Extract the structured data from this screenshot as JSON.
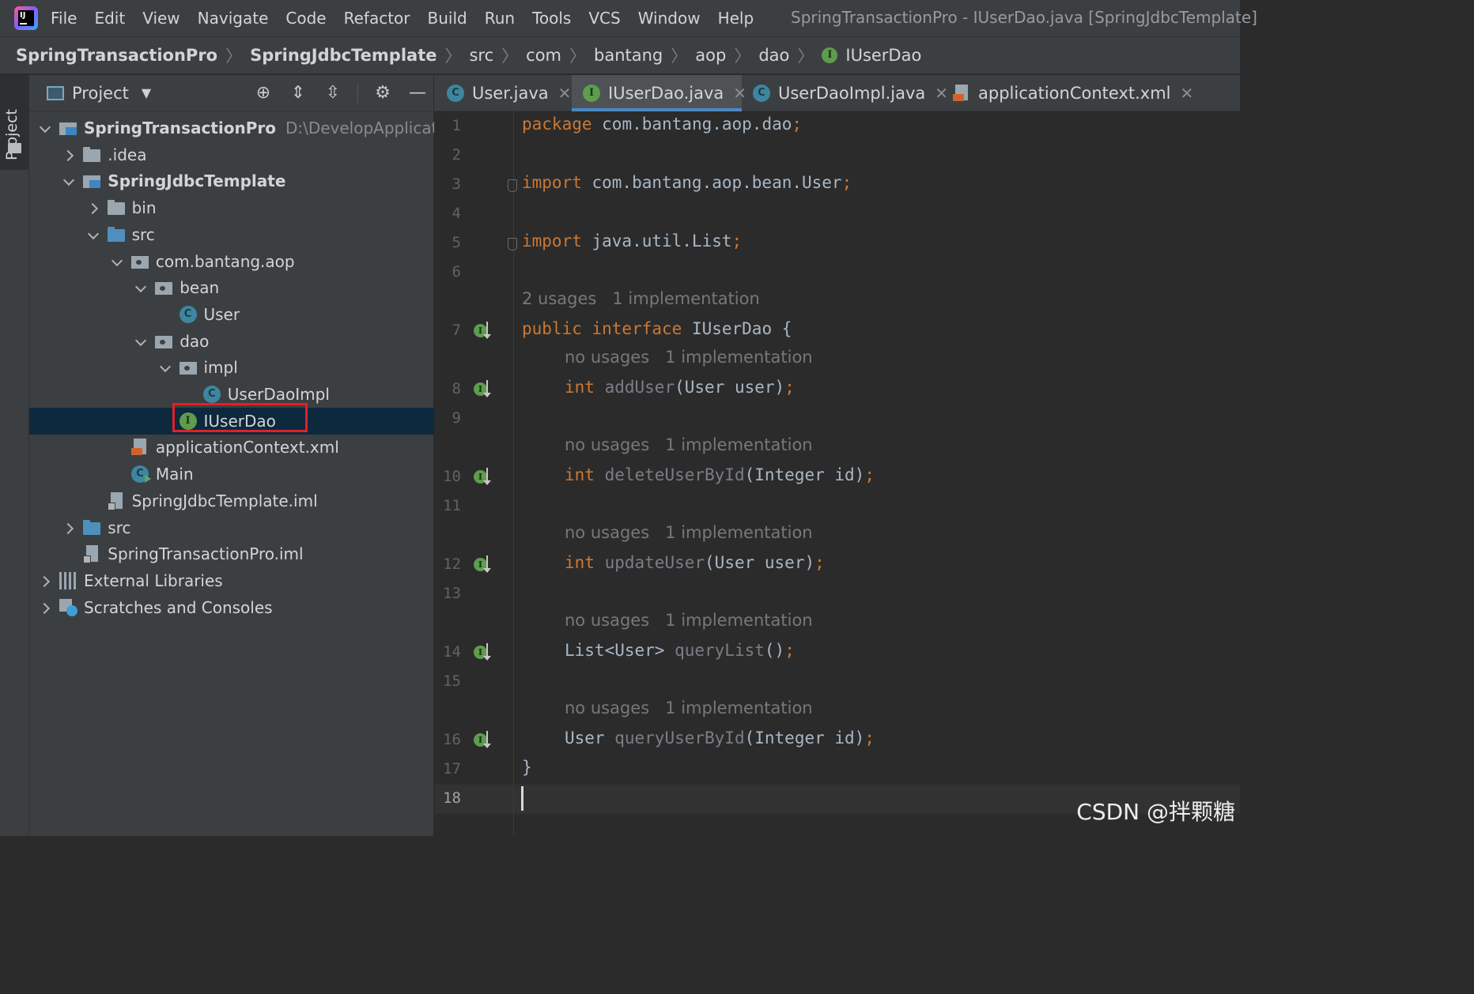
{
  "menubar": {
    "items": [
      "File",
      "Edit",
      "View",
      "Navigate",
      "Code",
      "Refactor",
      "Build",
      "Run",
      "Tools",
      "VCS",
      "Window",
      "Help"
    ],
    "window_title": "SpringTransactionPro - IUserDao.java [SpringJdbcTemplate]"
  },
  "breadcrumb": [
    "SpringTransactionPro",
    "SpringJdbcTemplate",
    "src",
    "com",
    "bantang",
    "aop",
    "dao",
    "IUserDao"
  ],
  "side_stripe": {
    "label": "Project"
  },
  "project_panel": {
    "title": "Project",
    "tree": [
      {
        "label": "SpringTransactionPro",
        "path": "D:\\DevelopApplicatio",
        "depth": 0,
        "arrow": "down",
        "icon": "module-folder",
        "bold": true
      },
      {
        "label": ".idea",
        "depth": 1,
        "arrow": "right",
        "icon": "folder"
      },
      {
        "label": "SpringJdbcTemplate",
        "depth": 1,
        "arrow": "down",
        "icon": "module-folder",
        "bold": true
      },
      {
        "label": "bin",
        "depth": 2,
        "arrow": "right",
        "icon": "folder"
      },
      {
        "label": "src",
        "depth": 2,
        "arrow": "down",
        "icon": "source-folder"
      },
      {
        "label": "com.bantang.aop",
        "depth": 3,
        "arrow": "down",
        "icon": "package"
      },
      {
        "label": "bean",
        "depth": 4,
        "arrow": "down",
        "icon": "package"
      },
      {
        "label": "User",
        "depth": 5,
        "arrow": "none",
        "icon": "class"
      },
      {
        "label": "dao",
        "depth": 4,
        "arrow": "down",
        "icon": "package"
      },
      {
        "label": "impl",
        "depth": 5,
        "arrow": "down",
        "icon": "package"
      },
      {
        "label": "UserDaoImpl",
        "depth": 6,
        "arrow": "none",
        "icon": "class"
      },
      {
        "label": "IUserDao",
        "depth": 5,
        "arrow": "none",
        "icon": "interface",
        "selected": true
      },
      {
        "label": "applicationContext.xml",
        "depth": 3,
        "arrow": "none",
        "icon": "xml"
      },
      {
        "label": "Main",
        "depth": 3,
        "arrow": "none",
        "icon": "main-class"
      },
      {
        "label": "SpringJdbcTemplate.iml",
        "depth": 2,
        "arrow": "none",
        "icon": "iml"
      },
      {
        "label": "src",
        "depth": 1,
        "arrow": "right",
        "icon": "source-folder"
      },
      {
        "label": "SpringTransactionPro.iml",
        "depth": 1,
        "arrow": "none",
        "icon": "iml"
      },
      {
        "label": "External Libraries",
        "depth": 0,
        "arrow": "right",
        "icon": "libraries"
      },
      {
        "label": "Scratches and Consoles",
        "depth": 0,
        "arrow": "right",
        "icon": "scratches"
      }
    ]
  },
  "tabs": [
    {
      "label": "User.java",
      "icon": "class",
      "active": false
    },
    {
      "label": "IUserDao.java",
      "icon": "interface",
      "active": true
    },
    {
      "label": "UserDaoImpl.java",
      "icon": "class",
      "active": false
    },
    {
      "label": "applicationContext.xml",
      "icon": "xml",
      "active": false
    }
  ],
  "editor": {
    "line_numbers": [
      "1",
      "2",
      "3",
      "4",
      "5",
      "6",
      "7",
      "8",
      "9",
      "10",
      "11",
      "12",
      "13",
      "14",
      "15",
      "16",
      "17",
      "18"
    ],
    "current_line": "18",
    "code": {
      "l1_kw": "package",
      "l1_rest": " com.bantang.aop.dao",
      "l1_semi": ";",
      "l3_kw": "import",
      "l3_rest": " com.bantang.aop.bean.User",
      "l3_semi": ";",
      "l5_kw": "import",
      "l5_rest": " java.util.List",
      "l5_semi": ";",
      "l7_kw": "public interface",
      "l7_rest": " IUserDao {",
      "l8_type": "int",
      "l8_name": "addUser",
      "l8_args": "(User user)",
      "l8_semi": ";",
      "l10_type": "int",
      "l10_name": "deleteUserById",
      "l10_args": "(Integer id)",
      "l10_semi": ";",
      "l12_type": "int",
      "l12_name": "updateUser",
      "l12_args": "(User user)",
      "l12_semi": ";",
      "l14_type": "List<User>",
      "l14_name": "queryList",
      "l14_args": "()",
      "l14_semi": ";",
      "l16_type": "User",
      "l16_name": "queryUserById",
      "l16_args": "(Integer id)",
      "l16_semi": ";",
      "l17": "}"
    },
    "hints": {
      "interface": "2 usages   1 implementation",
      "method": "no usages   1 implementation"
    }
  },
  "watermark": "CSDN @拌颗糖",
  "colors": {
    "keyword": "#cc7832",
    "text": "#a9b7c6",
    "hint": "#787878",
    "selection": "#0d293e",
    "highlight_box": "#e0202a"
  }
}
